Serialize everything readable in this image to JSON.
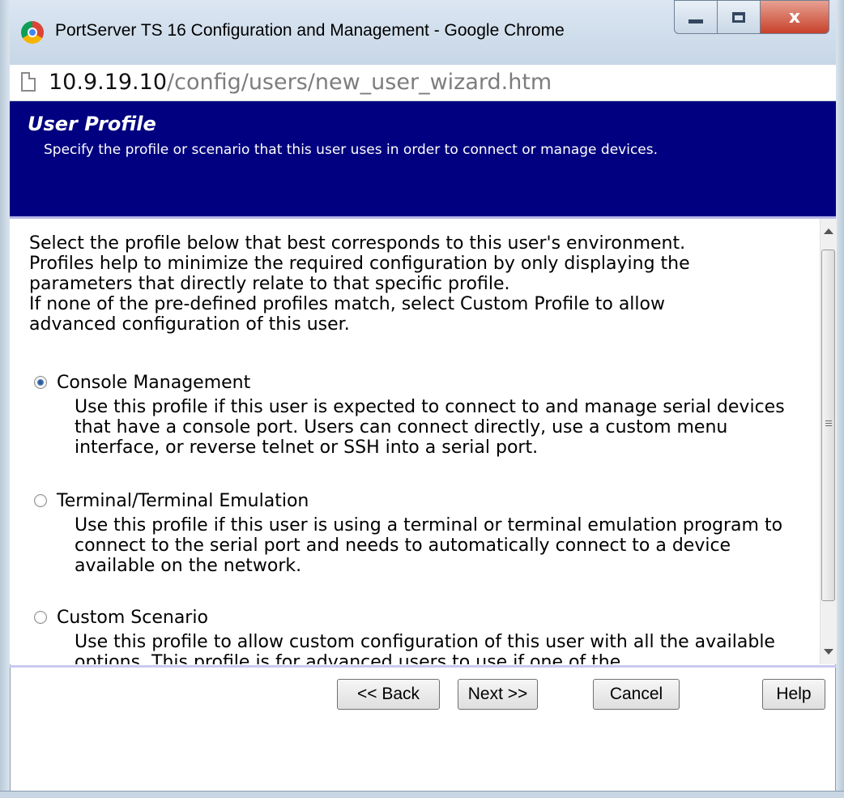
{
  "window": {
    "title": "PortServer TS 16 Configuration and Management - Google Chrome",
    "close_glyph": "x"
  },
  "address": {
    "host": "10.9.19.10",
    "path": "/config/users/new_user_wizard.htm"
  },
  "banner": {
    "title": "User Profile",
    "subtitle": "Specify the profile or scenario that this user uses in order to connect or manage devices.",
    "background_color": "#000080"
  },
  "intro": {
    "line1": "Select the profile below that best corresponds to this user's environment.",
    "line2": "Profiles help to minimize the required configuration by only displaying the",
    "line3": "parameters that directly relate to that specific profile.",
    "line4": "If none of the pre-defined profiles match, select Custom Profile to allow",
    "line5": "advanced configuration of this user."
  },
  "profiles": [
    {
      "label": "Console Management",
      "selected": true,
      "description": "Use this profile if this user is expected to connect to and manage serial devices that have a console port. Users can connect directly, use a custom menu interface, or reverse telnet or SSH into a serial port."
    },
    {
      "label": "Terminal/Terminal Emulation",
      "selected": false,
      "description": "Use this profile if this user is using a terminal or terminal emulation program to connect to the serial port and needs to automatically connect to a device available on the network."
    },
    {
      "label": "Custom Scenario",
      "selected": false,
      "description": "Use this profile to allow custom configuration of this user with all the available options. This profile is for advanced users to use if one of the"
    }
  ],
  "buttons": {
    "back": "<< Back",
    "next": "Next >>",
    "cancel": "Cancel",
    "help": "Help"
  },
  "icons": {
    "browser": "chrome-logo-icon",
    "page": "page-icon",
    "minimize": "minimize-icon",
    "maximize": "maximize-icon",
    "close": "close-icon"
  }
}
